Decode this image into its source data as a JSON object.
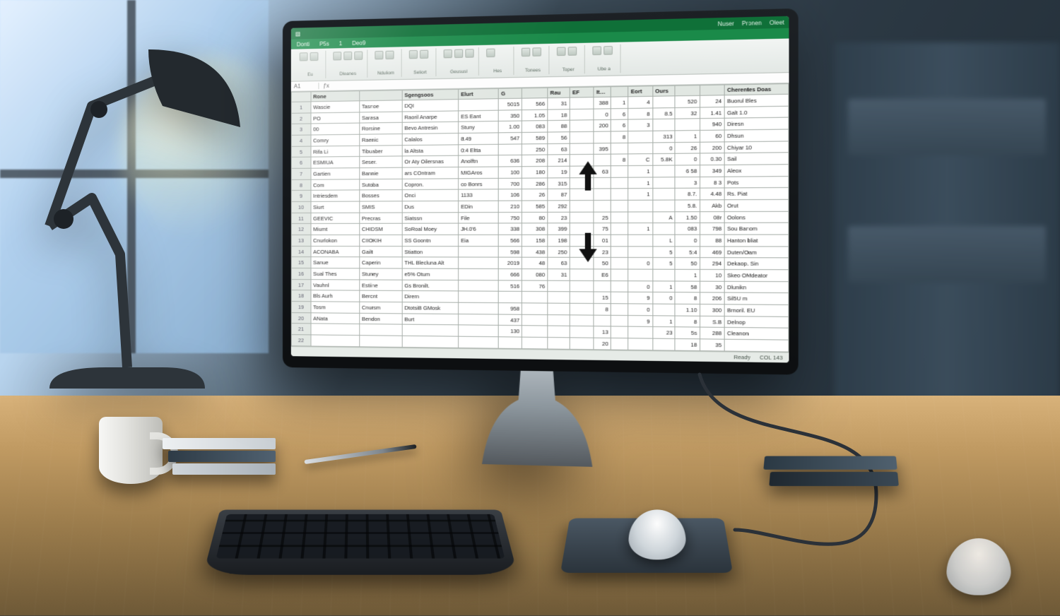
{
  "titlebar": {
    "word1": "Nuser",
    "word2": "Pronen",
    "word3": "Oleet"
  },
  "ribbon_tabs": [
    "Donti",
    "P5s",
    "1",
    "Deo9"
  ],
  "ribbon_groups": [
    {
      "label": "Eu",
      "items": [
        "Sb",
        "A"
      ]
    },
    {
      "label": "Dleanes",
      "items": [
        "ic",
        "ic",
        "ic"
      ]
    },
    {
      "label": "Nduliom",
      "items": [
        "ic",
        "ic"
      ]
    },
    {
      "label": "Seliort",
      "items": [
        "ic",
        "ic"
      ]
    },
    {
      "label": "Geususl",
      "items": [
        "ic",
        "ic",
        "ic"
      ]
    },
    {
      "label": "Hes",
      "items": [
        "ic"
      ]
    },
    {
      "label": "Tonees",
      "items": [
        "ic",
        "ic"
      ]
    },
    {
      "label": "Toper",
      "items": [
        "ic",
        "ic"
      ]
    },
    {
      "label": "Ube a",
      "items": [
        "ic",
        "ic"
      ]
    }
  ],
  "formula_bar": {
    "namebox": "A1",
    "content": ""
  },
  "columns": [
    "",
    "Rone",
    "",
    "Sgengsoos",
    "Elurt",
    "G",
    "",
    "Rau",
    "EF",
    "Itures",
    "",
    "Eort",
    "Ours",
    "",
    "",
    "Cherentes Doas"
  ],
  "rows": [
    {
      "n": 1,
      "a": "Wascie",
      "b": "Tasnoe",
      "c": "DQI",
      "d": "",
      "e": "5015",
      "f": "566",
      "g": "31",
      "h": "",
      "i": "388",
      "j": "1",
      "k": "4",
      "l": "",
      "m": "520",
      "n2": "24",
      "o": "Buorul Bles"
    },
    {
      "n": 2,
      "a": "PO",
      "b": "Sarasa",
      "c": "Raoril Anarpe",
      "d": "ES Eant",
      "e": "350",
      "f": "1.05",
      "g": "18",
      "h": "",
      "i": "0",
      "j": "6",
      "k": "8",
      "l": "8.5",
      "m": "32",
      "n2": "1.41",
      "o": "Galt 1.0"
    },
    {
      "n": 3,
      "a": "00",
      "b": "Rorsine",
      "c": "Bevo Antresin",
      "d": "Stuny",
      "e": "1.00",
      "f": "083",
      "g": "88",
      "h": "",
      "i": "200",
      "j": "6",
      "k": "3",
      "l": "",
      "m": "",
      "n2": "940",
      "o": "Diresn"
    },
    {
      "n": 4,
      "a": "Comry",
      "b": "Raenic",
      "c": "Calalos",
      "d": "8.49",
      "e": "547",
      "f": "589",
      "g": "56",
      "h": "",
      "i": "",
      "j": "8",
      "k": "",
      "l": "313",
      "m": "1",
      "n2": "60",
      "o": "Dhsun"
    },
    {
      "n": 5,
      "a": "Rifa Li",
      "b": "Tibuaber",
      "c": "la Altsta",
      "d": "0:4 Eltta",
      "e": "",
      "f": "250",
      "g": "63",
      "h": "",
      "i": "395",
      "j": "",
      "k": "",
      "l": "0",
      "m": "26",
      "n2": "200",
      "o": "Chiyar 10"
    },
    {
      "n": 6,
      "a": "ESMIUA",
      "b": "Seser.",
      "c": "Or Aty Oilersnas",
      "d": "Anolftn",
      "e": "636",
      "f": "208",
      "g": "214",
      "h": "",
      "i": "",
      "j": "8",
      "k": "C",
      "l": "5.8K",
      "m": "0",
      "n2": "0.30",
      "o": "Sail"
    },
    {
      "n": 7,
      "a": "Gartien",
      "b": "Bannie",
      "c": "ars COntram",
      "d": "MIGAros",
      "e": "100",
      "f": "180",
      "g": "19",
      "h": "",
      "i": "63",
      "j": "",
      "k": "1",
      "l": "",
      "m": "6 58",
      "n2": "349",
      "o": "Aleox"
    },
    {
      "n": 8,
      "a": "Com",
      "b": "Sutoba",
      "c": "Copron.",
      "d": "co Bonrs",
      "e": "700",
      "f": "286",
      "g": "315",
      "h": "",
      "i": "",
      "j": "",
      "k": "1",
      "l": "",
      "m": "3",
      "n2": "8 3",
      "o": "Pots"
    },
    {
      "n": 9,
      "a": "Intriesdem",
      "b": "Bosses",
      "c": "Onci",
      "d": "1133",
      "e": "106",
      "f": "26",
      "g": "87",
      "h": "",
      "i": "",
      "j": "",
      "k": "1",
      "l": "",
      "m": "8.7.",
      "n2": "4.48",
      "o": "Rs. Piat"
    },
    {
      "n": 10,
      "a": "Siurt",
      "b": "SMIS",
      "c": "Dus",
      "d": "EDin",
      "e": "210",
      "f": "585",
      "g": "292",
      "h": "",
      "i": "",
      "j": "",
      "k": "",
      "l": "",
      "m": "5.8.",
      "n2": "Akb",
      "o": "Orut"
    },
    {
      "n": 11,
      "a": "GEEVIC",
      "b": "Preoras",
      "c": "Siatssn",
      "d": "File",
      "e": "750",
      "f": "80",
      "g": "23",
      "h": "",
      "i": "25",
      "j": "",
      "k": "",
      "l": "A",
      "m": "1.50",
      "n2": "08r",
      "o": "Oolons"
    },
    {
      "n": 12,
      "a": "Miumt",
      "b": "CHIDSM",
      "c": "SoRoal Moey",
      "d": "JH.0'6",
      "e": "338",
      "f": "308",
      "g": "399",
      "h": "",
      "i": "75",
      "j": "",
      "k": "1",
      "l": "",
      "m": "083",
      "n2": "798",
      "o": "Sou Banom"
    },
    {
      "n": 13,
      "a": "Cnurlokon",
      "b": "CIIOKIH",
      "c": "SS Goontn",
      "d": "Eia",
      "e": "566",
      "f": "158",
      "g": "198",
      "h": "",
      "i": "01",
      "j": "",
      "k": "",
      "l": "L",
      "m": "0",
      "n2": "88",
      "o": "Hanton bliat"
    },
    {
      "n": 14,
      "a": "ACONABA",
      "b": "Gailt",
      "c": "Stiatton",
      "d": "",
      "e": "598",
      "f": "438",
      "g": "250",
      "h": "",
      "i": "23",
      "j": "",
      "k": "",
      "l": "5",
      "m": "5:4",
      "n2": "469",
      "o": "Duten/Oam"
    },
    {
      "n": 15,
      "a": "Sanue",
      "b": "Caperin",
      "c": "THL Blecluna Alt",
      "d": "",
      "e": "2019",
      "f": "48",
      "g": "63",
      "h": "",
      "i": "50",
      "j": "",
      "k": "0",
      "l": "5",
      "m": "50",
      "n2": "294",
      "o": "Dekaop. Sin"
    },
    {
      "n": 16,
      "a": "Sual Thes",
      "b": "Stuney",
      "c": "e5% Otum",
      "d": "",
      "e": "666",
      "f": "080",
      "g": "31",
      "h": "",
      "i": "E6",
      "j": "",
      "k": "",
      "l": "",
      "m": "1",
      "n2": "10",
      "o": "Skeo OMdeator"
    },
    {
      "n": 17,
      "a": "Vauhnl",
      "b": "Estiine",
      "c": "Gs Bronilt.",
      "d": "",
      "e": "516",
      "f": "76",
      "g": "",
      "h": "",
      "i": "",
      "j": "",
      "k": "0",
      "l": "1",
      "m": "58",
      "n2": "30",
      "o": "Dlunikn"
    },
    {
      "n": 18,
      "a": "Bls Aurh",
      "b": "Beront",
      "c": "Dirern",
      "d": "",
      "e": "",
      "f": "",
      "g": "",
      "h": "",
      "i": "15",
      "j": "",
      "k": "9",
      "l": "0",
      "m": "8",
      "n2": "206",
      "o": "Sil5U m"
    },
    {
      "n": 19,
      "a": "Tosm",
      "b": "Cnursm",
      "c": "DtotsiB GMosk",
      "d": "",
      "e": "958",
      "f": "",
      "g": "",
      "h": "",
      "i": "8",
      "j": "",
      "k": "0",
      "l": "",
      "m": "1.10",
      "n2": "300",
      "o": "Brnoril. EU"
    },
    {
      "n": 20,
      "a": "ANata",
      "b": "Bendon",
      "c": "Burt",
      "d": "",
      "e": "437",
      "f": "",
      "g": "",
      "h": "",
      "i": "",
      "j": "",
      "k": "9",
      "l": "1",
      "m": "8",
      "n2": "S.B",
      "o": "Delnop"
    },
    {
      "n": 21,
      "a": "",
      "b": "",
      "c": "",
      "d": "",
      "e": "130",
      "f": "",
      "g": "",
      "h": "",
      "i": "13",
      "j": "",
      "k": "",
      "l": "23",
      "m": "5s",
      "n2": "288",
      "o": "Cleanon"
    },
    {
      "n": 22,
      "a": "",
      "b": "",
      "c": "",
      "d": "",
      "e": "",
      "f": "",
      "g": "",
      "h": "",
      "i": "20",
      "j": "",
      "k": "",
      "l": "",
      "m": "18",
      "n2": "35",
      "o": ""
    }
  ],
  "statusbar": {
    "left": "Ready",
    "right": "COL 143"
  },
  "arrows": {
    "up": "↑",
    "down": "↓"
  }
}
